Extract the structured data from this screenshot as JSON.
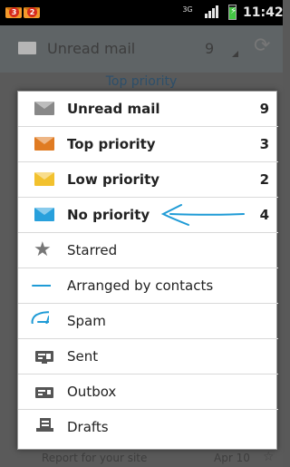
{
  "status_bar": {
    "time": "11:42",
    "network_type": "3G",
    "notifications": [
      {
        "icon": "email-notification-icon",
        "badge": "3"
      },
      {
        "icon": "gmail-notification-icon",
        "badge": "2"
      }
    ]
  },
  "header": {
    "title": "Unread mail",
    "count": "9",
    "section": "Top priority"
  },
  "background_row": {
    "subject": "Report for your site",
    "date": "Apr 10"
  },
  "menu": {
    "items": [
      {
        "label": "Unread mail",
        "count": "9",
        "icon": "mail-icon",
        "color": "#888888",
        "bold": true
      },
      {
        "label": "Top priority",
        "count": "3",
        "icon": "mail-icon",
        "color": "#e07b22",
        "bold": true
      },
      {
        "label": "Low priority",
        "count": "2",
        "icon": "mail-icon",
        "color": "#f2c12e",
        "bold": true
      },
      {
        "label": "No priority",
        "count": "4",
        "icon": "mail-icon",
        "color": "#28a0dc",
        "bold": true
      },
      {
        "label": "Starred",
        "count": "",
        "icon": "star-icon",
        "color": "#777777",
        "bold": false
      },
      {
        "label": "Arranged by contacts",
        "count": "",
        "icon": "arrow-annotation-icon",
        "color": "#1f9bd6",
        "bold": false
      },
      {
        "label": "Spam",
        "count": "",
        "icon": "spam-annotation-icon",
        "color": "#1f9bd6",
        "bold": false
      },
      {
        "label": "Sent",
        "count": "",
        "icon": "sent-icon",
        "color": "#555555",
        "bold": false
      },
      {
        "label": "Outbox",
        "count": "",
        "icon": "outbox-icon",
        "color": "#555555",
        "bold": false
      },
      {
        "label": "Drafts",
        "count": "",
        "icon": "drafts-icon",
        "color": "#555555",
        "bold": false
      }
    ]
  },
  "annotation_color": "#1f9bd6"
}
